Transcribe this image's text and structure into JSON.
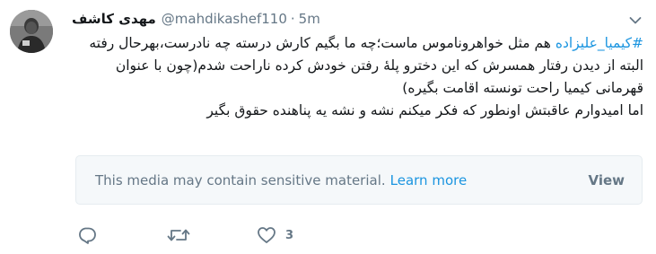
{
  "tweet": {
    "display_name": "مهدی کاشف",
    "handle": "@mahdikashef110",
    "separator": "·",
    "time": "5m",
    "lines": [
      {
        "hashtag": "#کیمیا_علیزاده",
        "text": " هم مثل خواهروناموس ماست؛چه ما بگیم کارش درسته چه نادرست،بهرحال رفته"
      },
      {
        "hashtag": "",
        "text": "البته از دیدن رفتار همسرش که این دخترو پلهٔ رفتن خودش کرده ناراحت شدم(چون با عنوان قهرمانی کیمیا راحت تونسته اقامت بگیره)"
      },
      {
        "hashtag": "",
        "text": "اما امیدوارم عاقبتش اونطور که فکر میکنم نشه و نشه یه پناهنده حقوق بگیر"
      }
    ]
  },
  "media_notice": {
    "message": "This media may contain sensitive material.",
    "learn_more": "Learn more",
    "view_label": "View"
  },
  "actions": {
    "reply_icon": "reply-icon",
    "retweet_icon": "retweet-icon",
    "like_icon": "like-icon",
    "like_count": "3"
  },
  "colors": {
    "link": "#1b95e0",
    "secondary": "#657786",
    "text": "#14171a",
    "media_bg": "#f5f8fa"
  }
}
